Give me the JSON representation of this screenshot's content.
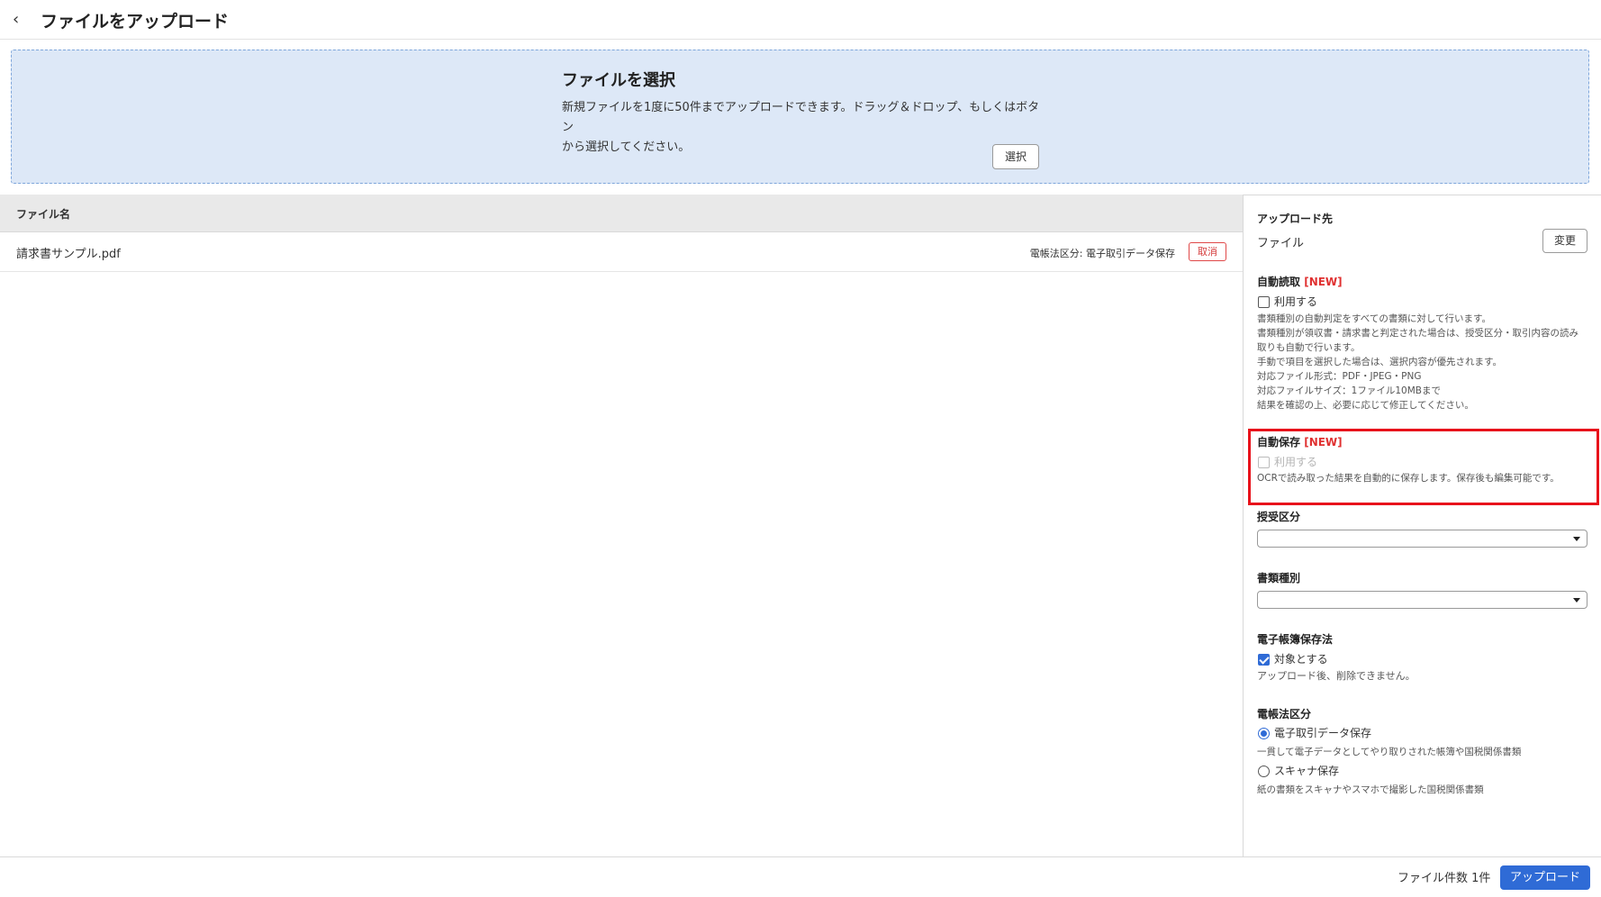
{
  "header": {
    "title": "ファイルをアップロード",
    "back_icon": "‹"
  },
  "dropzone": {
    "title": "ファイルを選択",
    "description_line1": "新規ファイルを1度に50件までアップロードできます。ドラッグ＆ドロップ、もしくはボタン",
    "description_line2": "から選択してください。",
    "select_button": "選択"
  },
  "file_table": {
    "header": "ファイル名",
    "rows": [
      {
        "name": "請求書サンプル.pdf",
        "tag": "電帳法区分: 電子取引データ保存",
        "cancel": "取消"
      }
    ]
  },
  "sidebar": {
    "upload_dest": {
      "label": "アップロード先",
      "value": "ファイル",
      "change_button": "変更"
    },
    "auto_read": {
      "label": "自動読取",
      "badge": "[NEW]",
      "checkbox_label": "利用する",
      "notes": [
        "書類種別の自動判定をすべての書類に対して行います。",
        "書類種別が領収書・請求書と判定された場合は、授受区分・取引内容の読み",
        "取りも自動で行います。",
        "手動で項目を選択した場合は、選択内容が優先されます。",
        "対応ファイル形式：PDF・JPEG・PNG",
        "対応ファイルサイズ：1ファイル10MBまで",
        "結果を確認の上、必要に応じて修正してください。"
      ]
    },
    "auto_save": {
      "label": "自動保存",
      "badge": "[NEW]",
      "checkbox_label": "利用する",
      "note": "OCRで読み取った結果を自動的に保存します。保存後も編集可能です。"
    },
    "transfer_type": {
      "label": "授受区分",
      "value": ""
    },
    "doc_type": {
      "label": "書類種別",
      "value": ""
    },
    "ebook_law": {
      "label": "電子帳簿保存法",
      "checkbox_label": "対象とする",
      "note": "アップロード後、削除できません。"
    },
    "ebook_class": {
      "label": "電帳法区分",
      "options": [
        {
          "label": "電子取引データ保存",
          "note": "一貫して電子データとしてやり取りされた帳簿や国税関係書類",
          "selected": true
        },
        {
          "label": "スキャナ保存",
          "note": "紙の書類をスキャナやスマホで撮影した国税関係書類",
          "selected": false
        }
      ]
    }
  },
  "footer": {
    "count": "ファイル件数 1件",
    "upload_button": "アップロード"
  },
  "colors": {
    "accent": "#2f6bd6",
    "highlight": "#e8121b",
    "dropzone_bg": "#dde8f7",
    "new_badge": "#e03131"
  }
}
